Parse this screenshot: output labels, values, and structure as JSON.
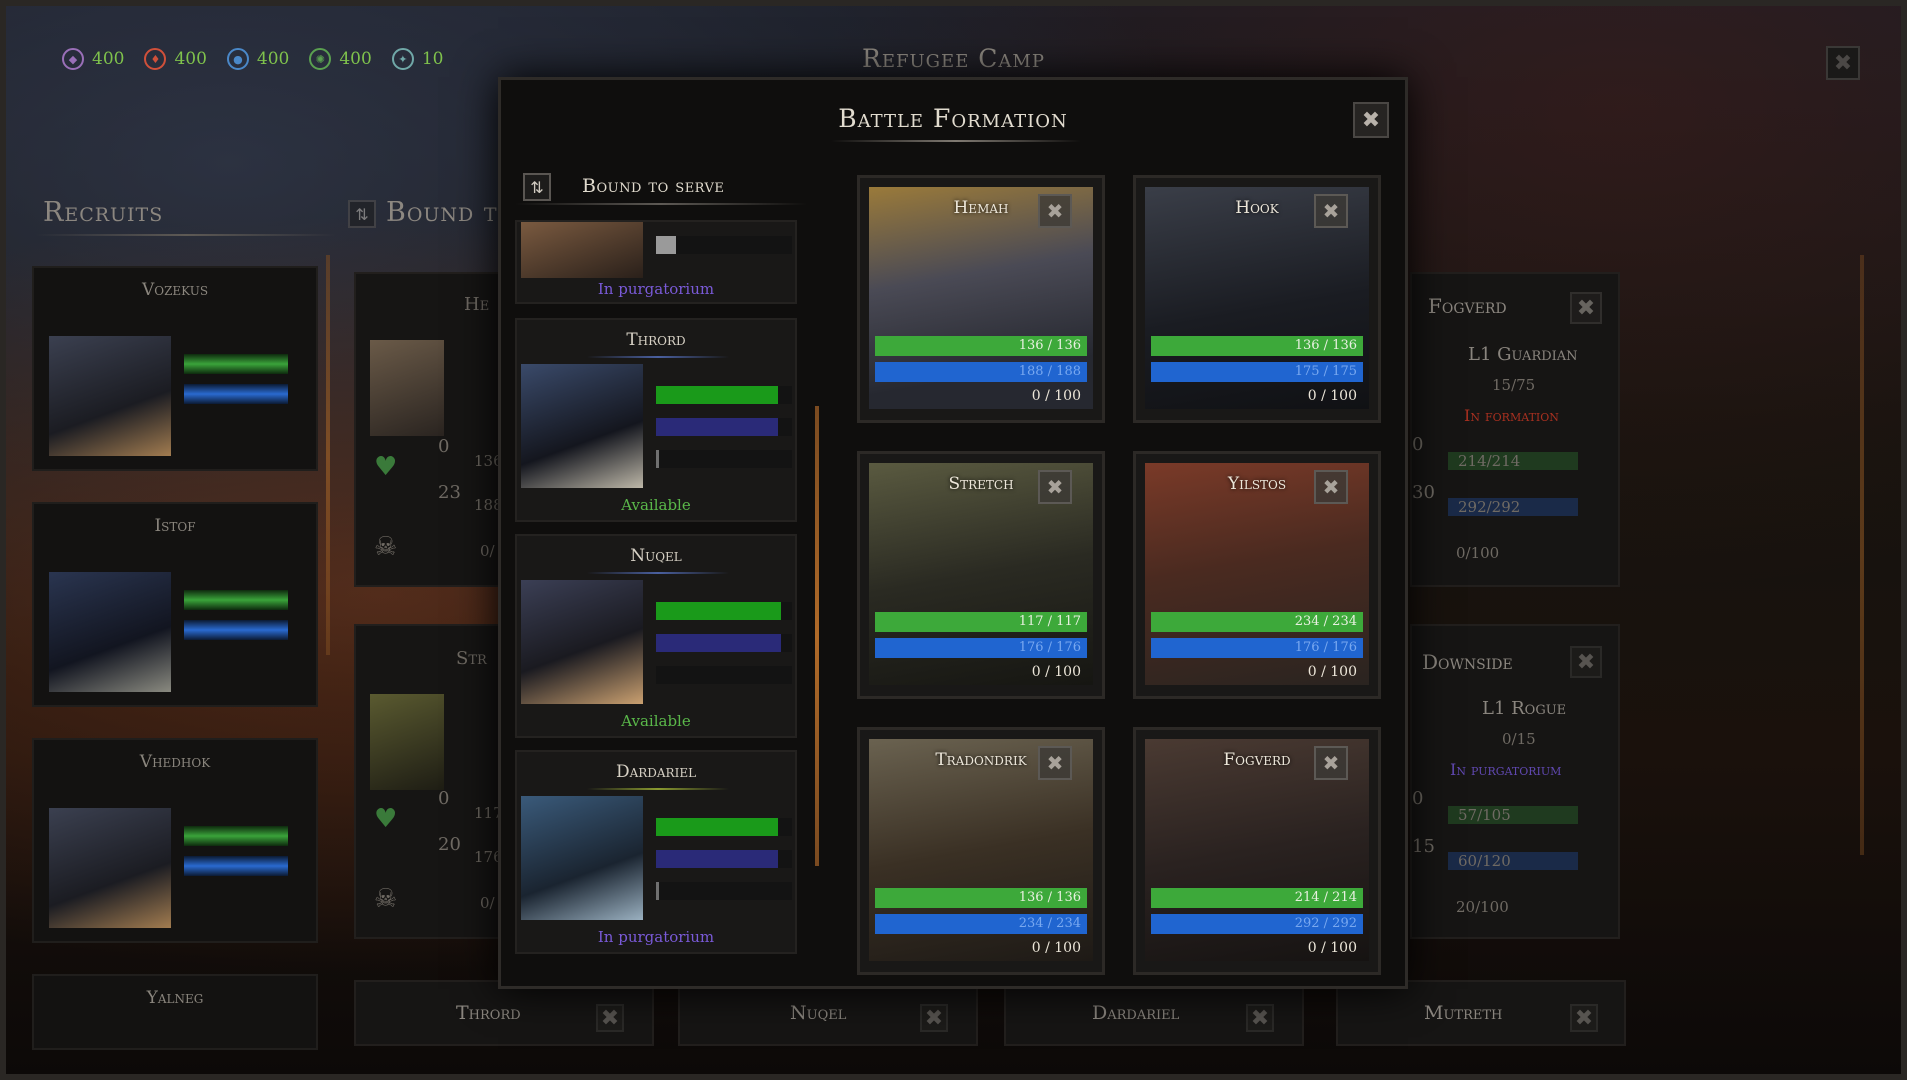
{
  "resources": [
    {
      "icon": "void-essence-icon",
      "value": "400",
      "color": "#9a6fb8"
    },
    {
      "icon": "fire-essence-icon",
      "value": "400",
      "color": "#d0503a"
    },
    {
      "icon": "water-essence-icon",
      "value": "400",
      "color": "#4a88c8"
    },
    {
      "icon": "nature-essence-icon",
      "value": "400",
      "color": "#5aa050"
    },
    {
      "icon": "soul-essence-icon",
      "value": "10",
      "color": "#70a8a8"
    }
  ],
  "camp_title": "Refugee Camp",
  "recruits": {
    "title": "Recruits",
    "cards": [
      {
        "name": "Vozekus"
      },
      {
        "name": "Istof"
      },
      {
        "name": "Vhedhok"
      },
      {
        "name": "Yalneg"
      }
    ]
  },
  "bound_bg": {
    "title": "Bound t",
    "left_cards": [
      {
        "name": "He",
        "v1": "0",
        "v2": "23",
        "hp": "136",
        "mp": "188",
        "xp": "0/"
      },
      {
        "name": "Str",
        "v1": "0",
        "v2": "20",
        "hp": "117",
        "mp": "176",
        "xp": "0/"
      }
    ],
    "right_cards": [
      {
        "name": "Fogverd",
        "class": "L1 Guardian",
        "exp": "15/75",
        "status": "In formation",
        "v1": "0",
        "v2": "30",
        "hp": "214/214",
        "mp": "292/292",
        "xp": "0/100",
        "status_color": "#d8402a"
      },
      {
        "name": "Downside",
        "class": "L1 Rogue",
        "exp": "0/15",
        "status": "In purgatorium",
        "v1": "0",
        "v2": "15",
        "hp": "57/105",
        "mp": "60/120",
        "xp": "20/100",
        "status_color": "#7a5ad8"
      }
    ],
    "bottom_row": [
      "Thrord",
      "Nuqel",
      "Dardariel",
      "Mutreth"
    ]
  },
  "modal": {
    "title": "Battle Formation",
    "bound_to_serve": {
      "title": "Bound to serve",
      "cards": [
        {
          "name": "",
          "status": "In purgatorium",
          "status_color": "#7a5ad8",
          "hp": 0.15,
          "mp": 0,
          "xp": 0
        },
        {
          "name": "Thrord",
          "status": "Available",
          "status_color": "#5ab84a",
          "hp": 0.9,
          "mp": 0.9,
          "xp": 0.02
        },
        {
          "name": "Nuqel",
          "status": "Available",
          "status_color": "#5ab84a",
          "hp": 0.92,
          "mp": 0.92,
          "xp": 0
        },
        {
          "name": "Dardariel",
          "status": "In purgatorium",
          "status_color": "#7a5ad8",
          "hp": 0.9,
          "mp": 0.9,
          "xp": 0.02
        }
      ]
    },
    "formation": [
      {
        "name": "Hemah",
        "hp": "136 / 136",
        "mp": "188 / 188",
        "xp": "0 / 100"
      },
      {
        "name": "Hook",
        "hp": "136 / 136",
        "mp": "175 / 175",
        "xp": "0 / 100"
      },
      {
        "name": "Stretch",
        "hp": "117 / 117",
        "mp": "176 / 176",
        "xp": "0 / 100"
      },
      {
        "name": "Yilstos",
        "hp": "234 / 234",
        "mp": "176 / 176",
        "xp": "0 / 100"
      },
      {
        "name": "Tradondrik",
        "hp": "136 / 136",
        "mp": "234 / 234",
        "xp": "0 / 100"
      },
      {
        "name": "Fogverd",
        "hp": "214 / 214",
        "mp": "292 / 292",
        "xp": "0 / 100"
      }
    ]
  }
}
